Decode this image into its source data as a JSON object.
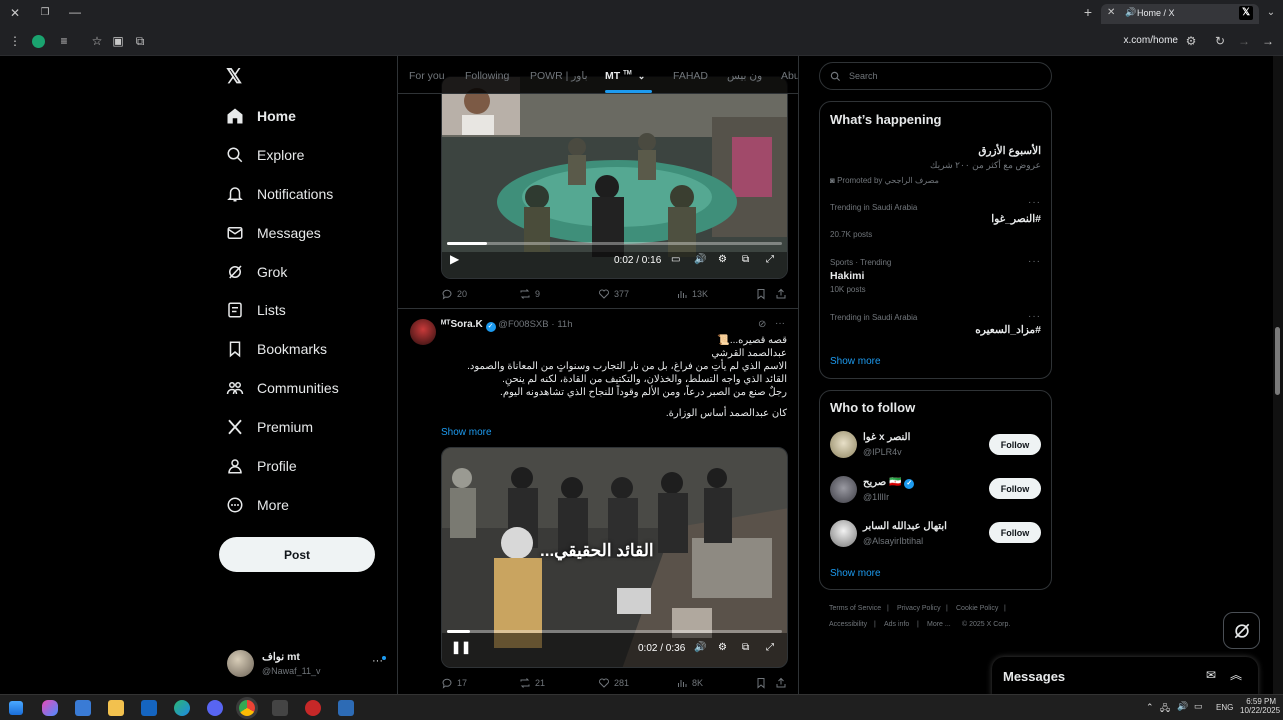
{
  "browser": {
    "tab_title": "Home / X",
    "url": "x.com/home"
  },
  "sidebar": {
    "items": [
      {
        "label": "Home",
        "icon": "home-icon"
      },
      {
        "label": "Explore",
        "icon": "search-icon"
      },
      {
        "label": "Notifications",
        "icon": "bell-icon"
      },
      {
        "label": "Messages",
        "icon": "envelope-icon"
      },
      {
        "label": "Grok",
        "icon": "grok-icon"
      },
      {
        "label": "Lists",
        "icon": "list-icon"
      },
      {
        "label": "Bookmarks",
        "icon": "bookmark-icon"
      },
      {
        "label": "Communities",
        "icon": "people-icon"
      },
      {
        "label": "Premium",
        "icon": "x-logo-icon"
      },
      {
        "label": "Profile",
        "icon": "person-icon"
      },
      {
        "label": "More",
        "icon": "more-circle-icon"
      }
    ],
    "post_label": "Post",
    "account": {
      "name": "نواف mt",
      "handle": "@Nawaf_11_v"
    }
  },
  "feed": {
    "tabs": [
      "For you",
      "Following",
      "POWR | باور",
      "MT",
      "FAHAD",
      "ون بيس",
      "Abu"
    ],
    "active_tab_badge": "TM",
    "tweet1": {
      "time_label": "0:02 / 0:16",
      "replies": "20",
      "reposts": "9",
      "likes": "377",
      "views": "13K",
      "progress": 0.12
    },
    "tweet2": {
      "author": "Sora.K",
      "author_prefix": "ᴹᵀ",
      "handle": "@F008SXB",
      "time": "11h",
      "lines": [
        "قصه قصيره...📜",
        "عبدالصمد القرشي",
        "الاسم الذي لم يأتِ من فراغ، بل من نار التجارب وسنواتٍ من المعاناة والصمود.",
        "القائد الذي واجه التسلط، والخذلان، والتكتيف من القادة، لكنه لم ينحنِ.",
        "رجلٌ صنع من الصبر درعاً، ومن الألم وقوداً للنجاح الذي تشاهدونه اليوم."
      ],
      "closing_line": "كان عبدالصمد أساس الوزارة.",
      "show_more": "Show more",
      "video_caption": "القائد الحقيقي...",
      "time_label": "0:02 / 0:36",
      "replies": "17",
      "reposts": "21",
      "likes": "281",
      "views": "8K",
      "progress": 0.07
    }
  },
  "right": {
    "search_placeholder": "Search",
    "happening": {
      "title": "What’s happening",
      "promo_title": "الأسبوع الأزرق",
      "promo_sub": "عروض مع أكثر من ٢٠٠ شريك",
      "promo_by": "Promoted by مصرف الراجحي",
      "trends": [
        {
          "context": "Trending in Saudi Arabia",
          "name": "#النصر_غوا",
          "posts": "20.7K posts"
        },
        {
          "context": "Sports · Trending",
          "name": "Hakimi",
          "posts": "10K posts"
        },
        {
          "context": "Trending in Saudi Arabia",
          "name": "#مزاد_السعيره",
          "posts": ""
        }
      ],
      "show_more": "Show more"
    },
    "who_to_follow": {
      "title": "Who to follow",
      "accounts": [
        {
          "name": "غوا x النصر",
          "handle": "@IPLR4v"
        },
        {
          "name": "صريح 🇮🇷",
          "handle": "@1IllIr"
        },
        {
          "name": "ابتهال عبدالله السابر",
          "handle": "@AlsayirIbtihal"
        }
      ],
      "follow_label": "Follow",
      "show_more": "Show more"
    },
    "footer": [
      "Terms of Service",
      "Privacy Policy",
      "Cookie Policy",
      "Accessibility",
      "Ads info",
      "More ...",
      "© 2025 X Corp."
    ],
    "messages_label": "Messages"
  },
  "taskbar": {
    "time": "6:59 PM",
    "date": "10/22/2025",
    "lang": "ENG"
  }
}
